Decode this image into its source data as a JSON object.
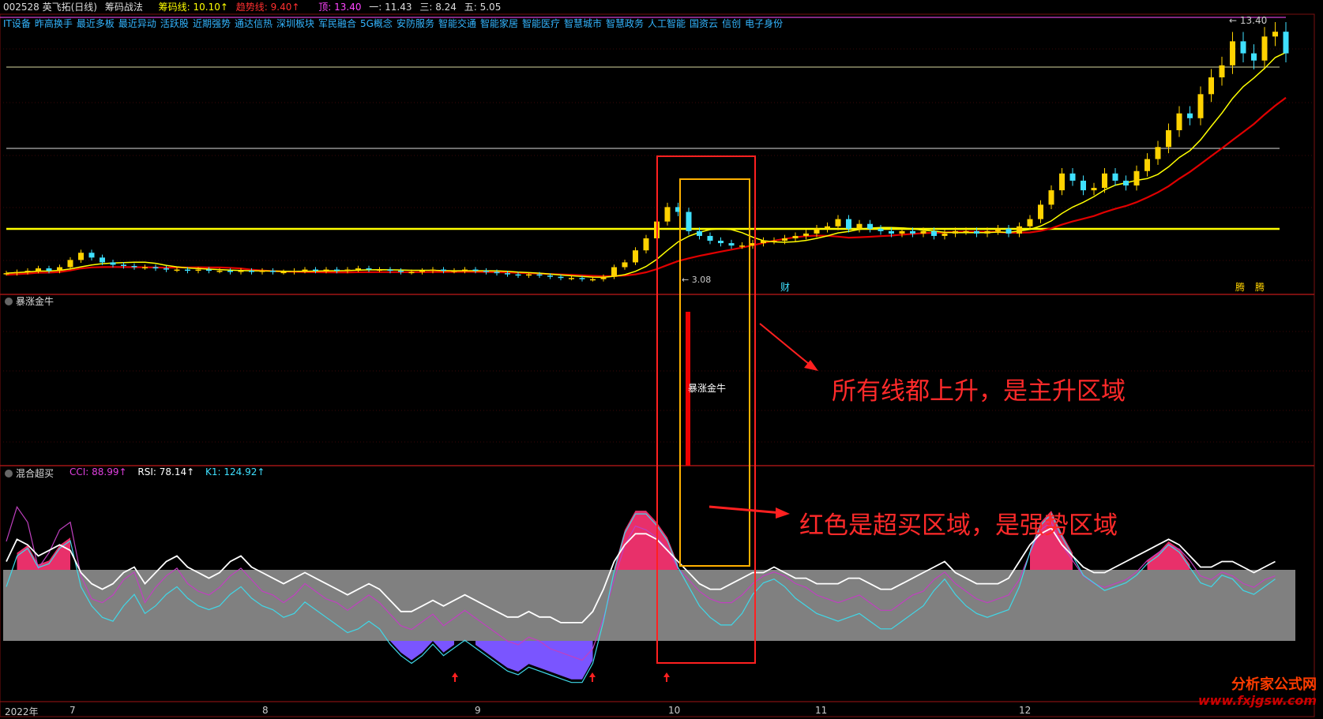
{
  "header": {
    "code_name": "002528 英飞拓(日线)",
    "indicator_name": "筹码战法",
    "chip_line": "筹码线: 10.10↑",
    "trend_line": "趋势线: 9.40↑",
    "top": "顶: 13.40",
    "one": "一: 11.43",
    "three": "三: 8.24",
    "five": "五: 5.05"
  },
  "sectors": [
    "IT设备",
    "昨高换手",
    "最近多板",
    "最近异动",
    "活跃股",
    "近期强势",
    "通达信热",
    "深圳板块",
    "军民融合",
    "5G概念",
    "安防服务",
    "智能交通",
    "智能家居",
    "智能医疗",
    "智慧城市",
    "智慧政务",
    "人工智能",
    "国资云",
    "信创",
    "电子身份"
  ],
  "price_labels": {
    "high": "13.40",
    "low": "3.08"
  },
  "badge_labels": {
    "cai": "财",
    "x1": "腾",
    "x2": "腾"
  },
  "panel2": {
    "title": "暴涨金牛",
    "label": "暴涨金牛"
  },
  "panel3": {
    "title": "混合超买",
    "cci": "CCI: 88.99↑",
    "rsi": "RSI: 78.14↑",
    "k1": "K1: 124.92↑"
  },
  "annotations": {
    "a1": "所有线都上升，是主升区域",
    "a2": "红色是超买区域，是强势区域"
  },
  "dates": [
    "2022年",
    "7",
    "8",
    "9",
    "10",
    "11",
    "12"
  ],
  "watermark": {
    "line1": "分析家公式网",
    "line2": "www.fxjgsw.com"
  },
  "colors": {
    "up": "#ffd200",
    "down": "#3fe0ff",
    "ma_red": "#e00000",
    "ma_yellow": "#ffff00",
    "overbought": "#e8306a",
    "oversold": "#7a55ff",
    "band": "#808080"
  },
  "chart_data": {
    "type": "candlestick",
    "price_closes": [
      3.35,
      3.4,
      3.45,
      3.55,
      3.45,
      3.6,
      3.9,
      4.2,
      4.0,
      3.8,
      3.7,
      3.65,
      3.6,
      3.6,
      3.55,
      3.5,
      3.5,
      3.45,
      3.5,
      3.45,
      3.45,
      3.4,
      3.45,
      3.4,
      3.45,
      3.4,
      3.4,
      3.45,
      3.5,
      3.45,
      3.5,
      3.45,
      3.5,
      3.55,
      3.5,
      3.5,
      3.45,
      3.4,
      3.4,
      3.45,
      3.5,
      3.45,
      3.45,
      3.5,
      3.45,
      3.4,
      3.35,
      3.3,
      3.25,
      3.3,
      3.25,
      3.2,
      3.15,
      3.15,
      3.1,
      3.1,
      3.2,
      3.6,
      3.8,
      4.3,
      4.8,
      5.5,
      6.1,
      5.9,
      5.1,
      4.9,
      4.7,
      4.6,
      4.5,
      4.5,
      4.6,
      4.7,
      4.7,
      4.8,
      4.9,
      5.0,
      5.2,
      5.3,
      5.6,
      5.2,
      5.4,
      5.2,
      5.1,
      5.0,
      5.1,
      5.0,
      5.1,
      4.9,
      5.0,
      5.1,
      5.1,
      5.0,
      5.1,
      5.2,
      5.0,
      5.3,
      5.6,
      6.2,
      6.8,
      7.5,
      7.2,
      6.8,
      6.9,
      7.5,
      7.2,
      7.0,
      7.6,
      8.1,
      8.6,
      9.3,
      10.0,
      9.8,
      10.8,
      11.5,
      12.0,
      13.0,
      12.5,
      12.2,
      13.2,
      13.4,
      12.5
    ],
    "cci_values": [
      102,
      120,
      112,
      88,
      96,
      108,
      112,
      84,
      72,
      70,
      74,
      82,
      86,
      70,
      78,
      84,
      88,
      80,
      76,
      74,
      78,
      84,
      88,
      82,
      76,
      74,
      70,
      74,
      80,
      76,
      72,
      70,
      66,
      70,
      74,
      70,
      64,
      58,
      56,
      60,
      64,
      58,
      62,
      66,
      62,
      58,
      54,
      50,
      48,
      52,
      50,
      46,
      44,
      42,
      40,
      46,
      62,
      82,
      100,
      110,
      108,
      104,
      98,
      88,
      82,
      76,
      72,
      70,
      70,
      74,
      80,
      84,
      86,
      84,
      80,
      78,
      74,
      72,
      70,
      72,
      74,
      70,
      66,
      66,
      70,
      74,
      76,
      82,
      86,
      80,
      76,
      72,
      70,
      72,
      74,
      82,
      96,
      108,
      112,
      100,
      92,
      84,
      80,
      78,
      80,
      82,
      86,
      92,
      96,
      100,
      98,
      92,
      84,
      82,
      86,
      84,
      80,
      78,
      82,
      84
    ],
    "rsi_values": [
      70,
      78,
      76,
      72,
      74,
      76,
      74,
      66,
      62,
      60,
      62,
      66,
      68,
      62,
      66,
      70,
      72,
      68,
      66,
      64,
      66,
      70,
      72,
      68,
      66,
      64,
      62,
      64,
      66,
      64,
      62,
      60,
      58,
      60,
      62,
      60,
      56,
      52,
      52,
      54,
      56,
      54,
      56,
      58,
      56,
      54,
      52,
      50,
      50,
      52,
      50,
      50,
      48,
      48,
      48,
      52,
      60,
      70,
      76,
      80,
      80,
      78,
      74,
      70,
      66,
      62,
      60,
      60,
      62,
      64,
      66,
      66,
      68,
      66,
      64,
      64,
      62,
      62,
      62,
      64,
      64,
      62,
      60,
      60,
      62,
      64,
      66,
      68,
      70,
      66,
      64,
      62,
      62,
      62,
      64,
      70,
      76,
      80,
      82,
      76,
      72,
      68,
      66,
      66,
      68,
      70,
      72,
      74,
      76,
      78,
      76,
      72,
      68,
      68,
      70,
      70,
      68,
      66,
      68,
      70
    ],
    "k1_values": [
      80,
      96,
      100,
      90,
      92,
      100,
      104,
      80,
      70,
      64,
      62,
      70,
      76,
      66,
      70,
      76,
      80,
      74,
      70,
      68,
      70,
      76,
      80,
      74,
      70,
      68,
      64,
      66,
      72,
      68,
      64,
      60,
      56,
      58,
      62,
      58,
      50,
      44,
      40,
      44,
      50,
      44,
      48,
      52,
      48,
      44,
      40,
      36,
      34,
      38,
      36,
      34,
      32,
      30,
      30,
      40,
      62,
      88,
      108,
      118,
      118,
      112,
      104,
      90,
      80,
      70,
      64,
      60,
      60,
      66,
      76,
      82,
      84,
      80,
      74,
      70,
      66,
      64,
      62,
      64,
      66,
      62,
      58,
      58,
      62,
      66,
      70,
      78,
      84,
      76,
      70,
      66,
      64,
      66,
      68,
      80,
      98,
      112,
      118,
      106,
      96,
      86,
      82,
      78,
      80,
      82,
      86,
      92,
      96,
      102,
      98,
      90,
      82,
      80,
      86,
      84,
      78,
      76,
      80,
      84
    ],
    "band": [
      20,
      80
    ],
    "ylim_price": [
      2.5,
      13.8
    ],
    "xlabel_dates": [
      "2022年",
      "7",
      "8",
      "9",
      "10",
      "11",
      "12"
    ]
  }
}
